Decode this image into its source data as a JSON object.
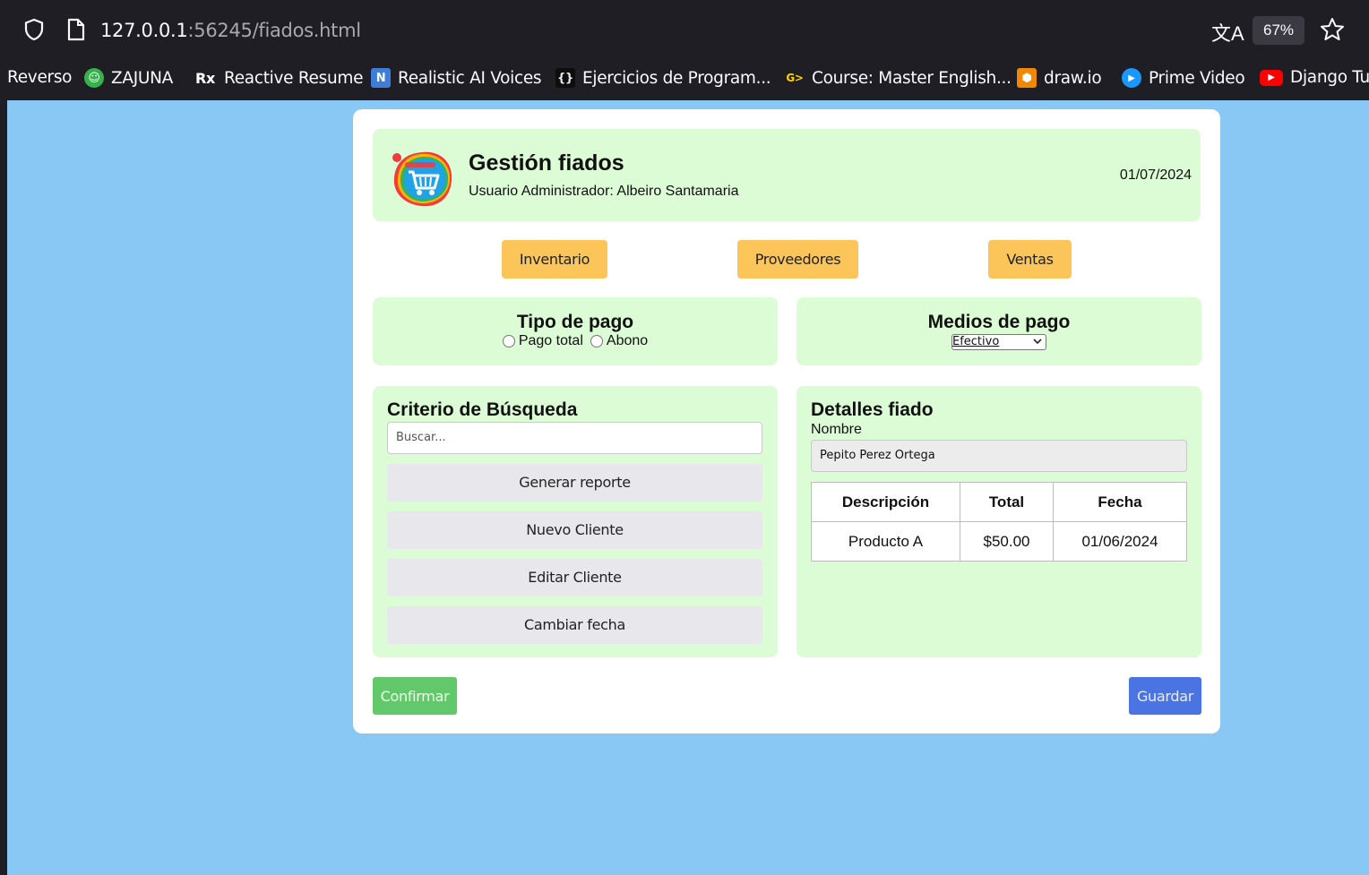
{
  "browser": {
    "url_host": "127.0.0.1",
    "url_path": ":56245/fiados.html",
    "zoom": "67%",
    "translate_glyph": "文A",
    "bookmarks": [
      {
        "label": "Reverso",
        "icon": "none"
      },
      {
        "label": "ZAJUNA",
        "icon": "zajuna-icon",
        "icon_color": "#36b24a"
      },
      {
        "label": "Reactive Resume",
        "icon": "rx-icon",
        "icon_glyph": "Rx"
      },
      {
        "label": "Realistic AI Voices",
        "icon": "n-icon",
        "icon_glyph": "N",
        "icon_color": "#3f7ed8"
      },
      {
        "label": "Ejercicios de Program...",
        "icon": "braces-icon",
        "icon_glyph": "{}"
      },
      {
        "label": "Course: Master English...",
        "icon": "course-icon",
        "icon_glyph": "G>"
      },
      {
        "label": "draw.io",
        "icon": "drawio-icon",
        "icon_color": "#f08705"
      },
      {
        "label": "Prime Video",
        "icon": "prime-video-icon",
        "icon_color": "#1a98ff"
      },
      {
        "label": "Django Tu",
        "icon": "youtube-icon",
        "icon_color": "#ff0000"
      }
    ]
  },
  "header": {
    "title": "Gestión fiados",
    "user": "Usuario Administrador: Albeiro Santamaria",
    "date": "01/07/2024"
  },
  "nav": {
    "inventario": "Inventario",
    "proveedores": "Proveedores",
    "ventas": "Ventas"
  },
  "tipo_pago": {
    "title": "Tipo de pago",
    "option_total": "Pago total",
    "option_abono": "Abono"
  },
  "medios_pago": {
    "title": "Medios de pago",
    "selected": "Efectivo"
  },
  "criterio": {
    "title": "Criterio de Búsqueda",
    "search_placeholder": "Buscar...",
    "buttons": [
      "Generar reporte",
      "Nuevo Cliente",
      "Editar Cliente",
      "Cambiar fecha"
    ]
  },
  "detalles": {
    "title": "Detalles fiado",
    "name_label": "Nombre",
    "name_value": "Pepito Perez Ortega",
    "columns": [
      "Descripción",
      "Total",
      "Fecha"
    ],
    "rows": [
      [
        "Producto A",
        "$50.00",
        "01/06/2024"
      ]
    ]
  },
  "actions": {
    "confirm": "Confirmar",
    "save": "Guardar"
  },
  "colors": {
    "page_background": "#89c8f4",
    "panel_background": "#dcfcd6",
    "nav_button": "#fbc55a",
    "confirm_button": "#62c96a",
    "save_button": "#4a74e2"
  }
}
